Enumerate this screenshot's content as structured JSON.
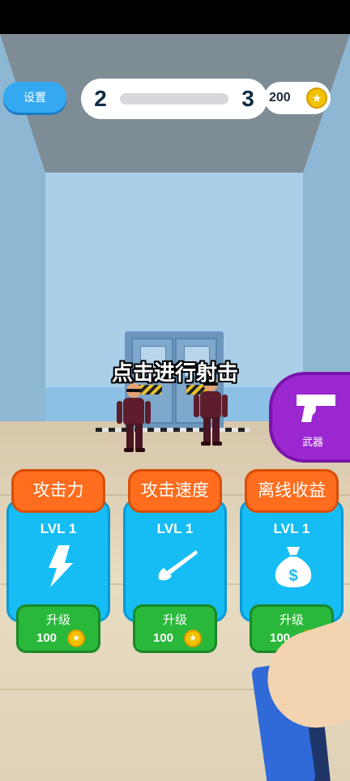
{
  "topbar": {
    "settings_label": "设置",
    "level_current": "2",
    "level_next": "3",
    "level_progress": 0,
    "coins": "200"
  },
  "hint": "点击进行射击",
  "weapon": {
    "label": "武器",
    "icon": "pistol-icon"
  },
  "upgrades": [
    {
      "title": "攻击力",
      "level": "LVL 1",
      "icon": "lightning-icon",
      "button_label": "升级",
      "cost": "100"
    },
    {
      "title": "攻击速度",
      "level": "LVL 1",
      "icon": "nail-icon",
      "button_label": "升级",
      "cost": "100"
    },
    {
      "title": "离线收益",
      "level": "LVL 1",
      "icon": "money-bag-icon",
      "button_label": "升级",
      "cost": "100"
    }
  ],
  "colors": {
    "accent_blue": "#16bdf4",
    "tab_orange": "#ff6d1e",
    "buy_green": "#2ab83b",
    "weapon_purple": "#9b27d1",
    "coin_gold": "#f2c200"
  }
}
